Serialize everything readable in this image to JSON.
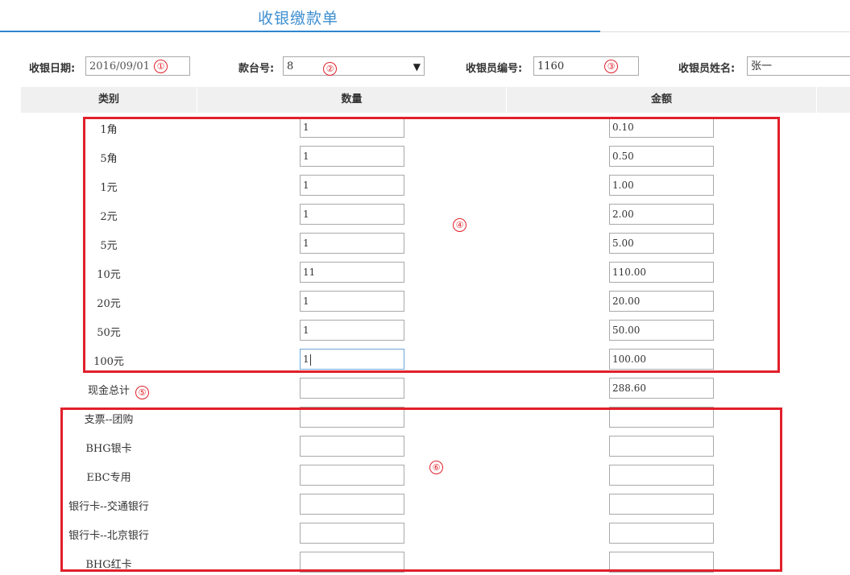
{
  "page": {
    "title": "收银缴款单"
  },
  "header": {
    "date": {
      "label": "收银日期:",
      "value": "2016/09/01"
    },
    "counter": {
      "label": "款台号:",
      "value": "8"
    },
    "cashier_id": {
      "label": "收银员编号:",
      "value": "1160"
    },
    "cashier_name": {
      "label": "收银员姓名:",
      "value": "张一"
    }
  },
  "table": {
    "headers": [
      "类别",
      "数量",
      "金额"
    ],
    "cash_rows": [
      {
        "label": "1角",
        "qty": "1",
        "amount": "0.10"
      },
      {
        "label": "5角",
        "qty": "1",
        "amount": "0.50"
      },
      {
        "label": "1元",
        "qty": "1",
        "amount": "1.00"
      },
      {
        "label": "2元",
        "qty": "1",
        "amount": "2.00"
      },
      {
        "label": "5元",
        "qty": "1",
        "amount": "5.00"
      },
      {
        "label": "10元",
        "qty": "11",
        "amount": "110.00"
      },
      {
        "label": "20元",
        "qty": "1",
        "amount": "20.00"
      },
      {
        "label": "50元",
        "qty": "1",
        "amount": "50.00"
      },
      {
        "label": "100元",
        "qty": "1",
        "amount": "100.00"
      }
    ],
    "cash_total": {
      "label": "现金总计",
      "qty": "",
      "amount": "288.60"
    },
    "other_rows": [
      {
        "label": "支票--团购",
        "qty": "",
        "amount": ""
      },
      {
        "label": "BHG银卡",
        "qty": "",
        "amount": ""
      },
      {
        "label": "EBC专用",
        "qty": "",
        "amount": ""
      },
      {
        "label": "银行卡--交通银行",
        "qty": "",
        "amount": ""
      },
      {
        "label": "银行卡--北京银行",
        "qty": "",
        "amount": ""
      },
      {
        "label": "BHG红卡",
        "qty": "",
        "amount": ""
      }
    ]
  },
  "annotations": [
    "①",
    "②",
    "③",
    "④",
    "⑤",
    "⑥"
  ],
  "colors": {
    "accent": "#2e86cf",
    "title": "#3f8fd0",
    "annotation_red": "#e0202b",
    "header_bg": "#f0f0f0"
  }
}
